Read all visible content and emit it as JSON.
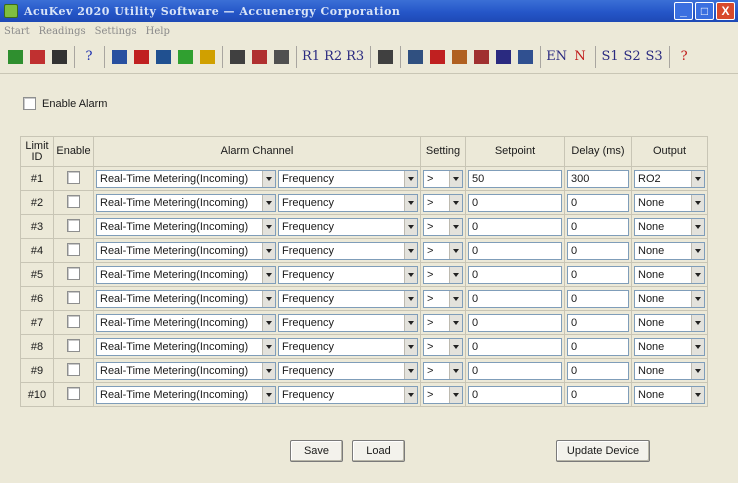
{
  "window": {
    "title": "AcuKev 2020 Utility Software  —  Accuenergy Corporation",
    "controls": {
      "minimize": "_",
      "maximize": "□",
      "close": "X"
    }
  },
  "menu": [
    "Start",
    "Readings",
    "Settings",
    "Help"
  ],
  "toolbar": {
    "groups": [
      [
        {
          "icon": "meter-icon",
          "color": "#2f8f2f"
        },
        {
          "icon": "car-icon",
          "color": "#c03030"
        },
        {
          "icon": "grid-icon",
          "color": "#333333"
        }
      ],
      [
        {
          "icon": "help-cursor-icon",
          "label": "?",
          "color": "#1c2fb0"
        }
      ],
      [
        {
          "icon": "panel-icon",
          "color": "#2850a0"
        },
        {
          "icon": "bar-chart-icon",
          "color": "#c02020"
        },
        {
          "icon": "table-icon",
          "color": "#205090"
        },
        {
          "icon": "wave-icon",
          "color": "#30a030"
        },
        {
          "icon": "lightbulb-icon",
          "color": "#d0a000"
        }
      ],
      [
        {
          "icon": "gauge-icon",
          "color": "#404040"
        },
        {
          "icon": "clock-icon",
          "color": "#b03030"
        },
        {
          "icon": "lock-icon",
          "color": "#505050"
        }
      ],
      [
        {
          "icon": "r1-icon",
          "label": "R1",
          "color": "#2a2a80"
        },
        {
          "icon": "r2-icon",
          "label": "R2",
          "color": "#2a2a80"
        },
        {
          "icon": "r3-icon",
          "label": "R3",
          "color": "#2a2a80"
        }
      ],
      [
        {
          "icon": "document-icon",
          "color": "#404040"
        }
      ],
      [
        {
          "icon": "waveform-icon",
          "color": "#305080"
        },
        {
          "icon": "harmonics-icon",
          "color": "#c02020"
        },
        {
          "icon": "arrow-right-icon",
          "color": "#b06020"
        },
        {
          "icon": "event-icon",
          "color": "#a03030"
        },
        {
          "icon": "e-icon",
          "color": "#2a2a80"
        },
        {
          "icon": "calculator-icon",
          "color": "#305090"
        }
      ],
      [
        {
          "icon": "en-icon",
          "label": "EN",
          "color": "#2a2a80"
        },
        {
          "icon": "n-icon",
          "label": "N",
          "color": "#c01818"
        }
      ],
      [
        {
          "icon": "s1-icon",
          "label": "S1",
          "color": "#2a2a80"
        },
        {
          "icon": "s2-icon",
          "label": "S2",
          "color": "#2a2a80"
        },
        {
          "icon": "s3-icon",
          "label": "S3",
          "color": "#2a2a80"
        }
      ],
      [
        {
          "icon": "question-icon",
          "label": "?",
          "color": "#c01818"
        }
      ]
    ]
  },
  "alarm_enable": {
    "label": "Enable Alarm",
    "checked": false
  },
  "table": {
    "headers": {
      "limit_id": "Limit ID",
      "enable": "Enable",
      "alarm_channel": "Alarm Channel",
      "setting": "Setting",
      "setpoint": "Setpoint",
      "delay": "Delay (ms)",
      "output": "Output"
    },
    "rows": [
      {
        "id": "#1",
        "enabled": false,
        "source": "Real-Time Metering(Incoming)",
        "parameter": "Frequency",
        "setting": ">",
        "setpoint": "50",
        "delay": "300",
        "output": "RO2"
      },
      {
        "id": "#2",
        "enabled": false,
        "source": "Real-Time Metering(Incoming)",
        "parameter": "Frequency",
        "setting": ">",
        "setpoint": "0",
        "delay": "0",
        "output": "None"
      },
      {
        "id": "#3",
        "enabled": false,
        "source": "Real-Time Metering(Incoming)",
        "parameter": "Frequency",
        "setting": ">",
        "setpoint": "0",
        "delay": "0",
        "output": "None"
      },
      {
        "id": "#4",
        "enabled": false,
        "source": "Real-Time Metering(Incoming)",
        "parameter": "Frequency",
        "setting": ">",
        "setpoint": "0",
        "delay": "0",
        "output": "None"
      },
      {
        "id": "#5",
        "enabled": false,
        "source": "Real-Time Metering(Incoming)",
        "parameter": "Frequency",
        "setting": ">",
        "setpoint": "0",
        "delay": "0",
        "output": "None"
      },
      {
        "id": "#6",
        "enabled": false,
        "source": "Real-Time Metering(Incoming)",
        "parameter": "Frequency",
        "setting": ">",
        "setpoint": "0",
        "delay": "0",
        "output": "None"
      },
      {
        "id": "#7",
        "enabled": false,
        "source": "Real-Time Metering(Incoming)",
        "parameter": "Frequency",
        "setting": ">",
        "setpoint": "0",
        "delay": "0",
        "output": "None"
      },
      {
        "id": "#8",
        "enabled": false,
        "source": "Real-Time Metering(Incoming)",
        "parameter": "Frequency",
        "setting": ">",
        "setpoint": "0",
        "delay": "0",
        "output": "None"
      },
      {
        "id": "#9",
        "enabled": false,
        "source": "Real-Time Metering(Incoming)",
        "parameter": "Frequency",
        "setting": ">",
        "setpoint": "0",
        "delay": "0",
        "output": "None"
      },
      {
        "id": "#10",
        "enabled": false,
        "source": "Real-Time Metering(Incoming)",
        "parameter": "Frequency",
        "setting": ">",
        "setpoint": "0",
        "delay": "0",
        "output": "None"
      }
    ]
  },
  "buttons": {
    "save": "Save",
    "load": "Load",
    "update": "Update Device"
  }
}
